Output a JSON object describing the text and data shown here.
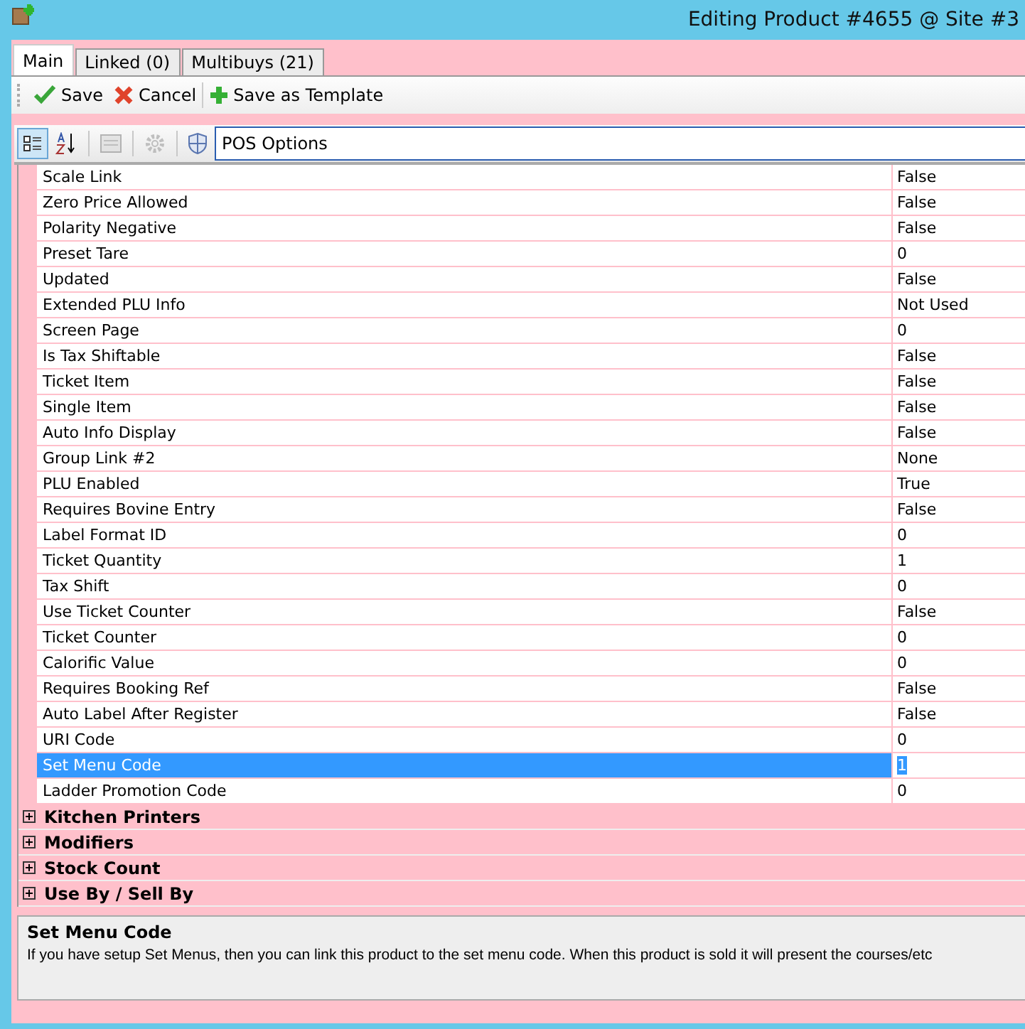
{
  "window": {
    "title": "Editing Product #4655 @ Site #3"
  },
  "tabs": [
    {
      "label": "Main",
      "selected": true
    },
    {
      "label": "Linked (0)",
      "selected": false
    },
    {
      "label": "Multibuys (21)",
      "selected": false
    }
  ],
  "toolbar": [
    {
      "label": "Save",
      "kind": "save"
    },
    {
      "label": "Cancel",
      "kind": "cancel"
    },
    {
      "label": "Save as Template",
      "kind": "template"
    }
  ],
  "grid_toolbar": {
    "categorized_selected": true,
    "category": "POS Options"
  },
  "properties": [
    {
      "name": "Scale Link",
      "value": "False",
      "selected": false
    },
    {
      "name": "Zero Price Allowed",
      "value": "False",
      "selected": false
    },
    {
      "name": "Polarity Negative",
      "value": "False",
      "selected": false
    },
    {
      "name": "Preset Tare",
      "value": "0",
      "selected": false
    },
    {
      "name": "Updated",
      "value": "False",
      "selected": false
    },
    {
      "name": "Extended PLU Info",
      "value": "Not Used",
      "selected": false
    },
    {
      "name": "Screen Page",
      "value": "0",
      "selected": false
    },
    {
      "name": "Is Tax Shiftable",
      "value": "False",
      "selected": false
    },
    {
      "name": "Ticket Item",
      "value": "False",
      "selected": false
    },
    {
      "name": "Single Item",
      "value": "False",
      "selected": false
    },
    {
      "name": "Auto Info Display",
      "value": "False",
      "selected": false
    },
    {
      "name": "Group Link #2",
      "value": "None",
      "selected": false
    },
    {
      "name": "PLU Enabled",
      "value": "True",
      "selected": false
    },
    {
      "name": "Requires Bovine Entry",
      "value": "False",
      "selected": false
    },
    {
      "name": "Label Format ID",
      "value": "0",
      "selected": false
    },
    {
      "name": "Ticket Quantity",
      "value": "1",
      "selected": false
    },
    {
      "name": "Tax Shift",
      "value": "0",
      "selected": false
    },
    {
      "name": "Use Ticket Counter",
      "value": "False",
      "selected": false
    },
    {
      "name": "Ticket Counter",
      "value": "0",
      "selected": false
    },
    {
      "name": "Calorific Value",
      "value": "0",
      "selected": false
    },
    {
      "name": "Requires Booking Ref",
      "value": "False",
      "selected": false
    },
    {
      "name": "Auto Label After Register",
      "value": "False",
      "selected": false
    },
    {
      "name": "URI Code",
      "value": "0",
      "selected": false
    },
    {
      "name": "Set Menu Code",
      "value": "1",
      "selected": true
    },
    {
      "name": "Ladder Promotion Code",
      "value": "0",
      "selected": false
    }
  ],
  "categories": [
    {
      "label": "Kitchen Printers",
      "expanded": false
    },
    {
      "label": "Modifiers",
      "expanded": false
    },
    {
      "label": "Stock Count",
      "expanded": false
    },
    {
      "label": "Use By / Sell By",
      "expanded": false
    }
  ],
  "description": {
    "title": "Set Menu Code",
    "text": "If you have setup Set Menus, then you can link this product to the set menu code. When this product is sold it will present the courses/etc"
  }
}
